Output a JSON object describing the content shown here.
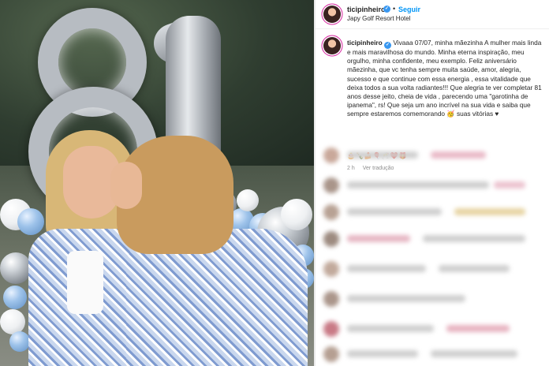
{
  "post": {
    "username": "ticipinheiro",
    "follow_label": "Seguir",
    "separator": "•",
    "location": "Japy Golf Resort Hotel",
    "verified_badge": "✓",
    "caption_user": "ticipinheiro",
    "caption_text": "Vivaaa 07/07, minha mãezinha A mulher mais linda e mais maravilhosa do mundo. Minha eterna inspiração, meu orgulho, minha confidente, meu exemplo. Feliz aniversário mãezinha, que vc tenha sempre muita saúde, amor, alegria, sucesso e que continue com essa energia , essa vitalidade que deixa todos a sua volta radiantes!!! Que alegria te ver completar 81 anos desse jeito, cheia de vida , parecendo uma \"garotinha de ipanema\", rs! Que seja um ano incrível na sua vida e saiba que sempre estaremos comemorando 🥳 suas vitórias ♥",
    "caption_emojis": "🎂🍾🍰🎈🥂❤️🎁",
    "time_ago": "2 h",
    "translate_label": "Ver tradução"
  },
  "icons": {
    "avatar": "avatar-icon",
    "verified": "verified-icon"
  },
  "colors": {
    "link_blue": "#0095f6",
    "verified_blue": "#3897f0",
    "text_primary": "#262626",
    "text_secondary": "#8e8e8e",
    "balloon_silver": "#b7bcc2",
    "balloon_blue": "#9ec3ea"
  }
}
